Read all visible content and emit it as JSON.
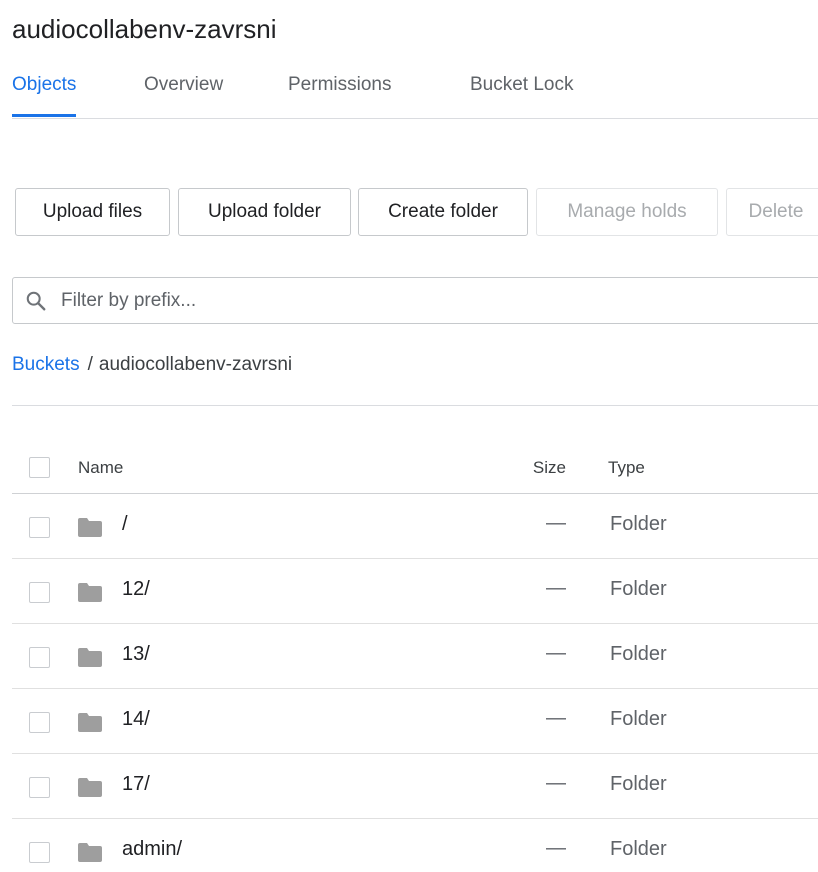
{
  "bucket": {
    "name": "audiocollabenv-zavrsni"
  },
  "tabs": [
    {
      "label": "Objects",
      "active": true
    },
    {
      "label": "Overview",
      "active": false
    },
    {
      "label": "Permissions",
      "active": false
    },
    {
      "label": "Bucket Lock",
      "active": false
    }
  ],
  "toolbar": {
    "upload_files": "Upload files",
    "upload_folder": "Upload folder",
    "create_folder": "Create folder",
    "manage_holds": "Manage holds",
    "delete": "Delete"
  },
  "filter": {
    "placeholder": "Filter by prefix...",
    "icon": "search-icon"
  },
  "breadcrumb": {
    "root": "Buckets",
    "separator": "/",
    "current": "audiocollabenv-zavrsni"
  },
  "table": {
    "columns": {
      "name": "Name",
      "size": "Size",
      "type": "Type"
    },
    "rows": [
      {
        "name": "/",
        "size": "—",
        "type": "Folder"
      },
      {
        "name": "12/",
        "size": "—",
        "type": "Folder"
      },
      {
        "name": "13/",
        "size": "—",
        "type": "Folder"
      },
      {
        "name": "14/",
        "size": "—",
        "type": "Folder"
      },
      {
        "name": "17/",
        "size": "—",
        "type": "Folder"
      },
      {
        "name": "admin/",
        "size": "—",
        "type": "Folder"
      }
    ]
  },
  "colors": {
    "accent": "#1a73e8",
    "folder_icon": "#9e9e9e",
    "disabled_text": "#a8abae"
  }
}
